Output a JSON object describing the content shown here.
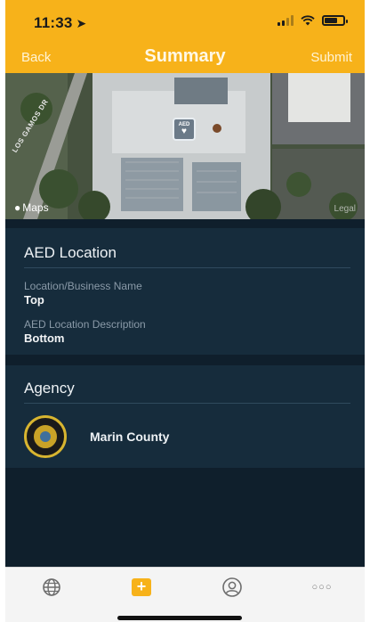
{
  "status_bar": {
    "time": "11:33"
  },
  "nav": {
    "back_label": "Back",
    "title": "Summary",
    "submit_label": "Submit"
  },
  "map": {
    "provider_label": "Maps",
    "legal_label": "Legal",
    "road_label": "LOS GAMOS DR",
    "pin_label": "AED"
  },
  "aed_location": {
    "section_title": "AED Location",
    "name_label": "Location/Business Name",
    "name_value": "Top",
    "description_label": "AED Location Description",
    "description_value": "Bottom"
  },
  "agency": {
    "section_title": "Agency",
    "name": "Marin County"
  },
  "tabbar": {
    "items": [
      "globe-icon",
      "add-icon",
      "profile-icon",
      "more-icon"
    ]
  },
  "colors": {
    "brand_yellow": "#f7b21a",
    "background": "#0f1f2c",
    "card": "#162c3c"
  }
}
